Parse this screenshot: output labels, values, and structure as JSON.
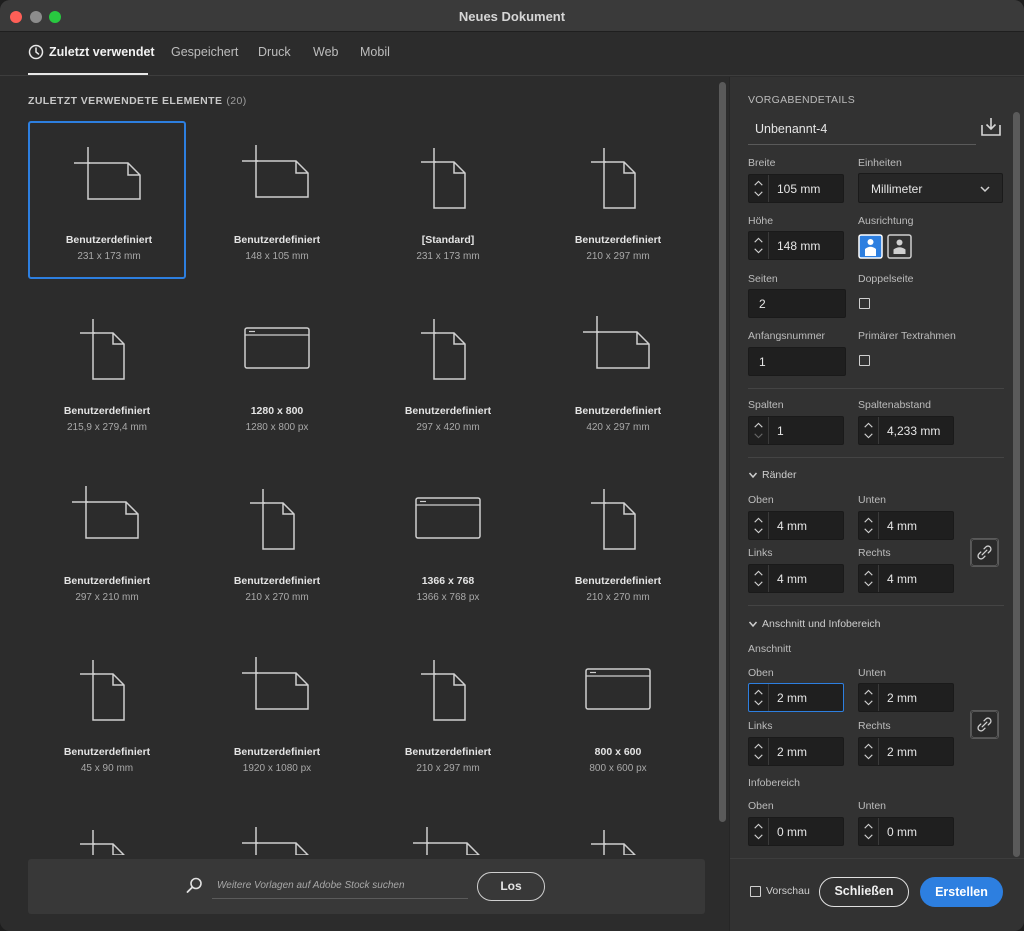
{
  "window": {
    "title": "Neues Dokument"
  },
  "tabs": [
    {
      "label": "Zuletzt verwendet",
      "active": true,
      "icon": "clock-icon"
    },
    {
      "label": "Gespeichert",
      "active": false
    },
    {
      "label": "Druck",
      "active": false
    },
    {
      "label": "Web",
      "active": false
    },
    {
      "label": "Mobil",
      "active": false
    }
  ],
  "recent": {
    "heading": "ZULETZT VERWENDETE ELEMENTE",
    "count": "(20)",
    "items": [
      {
        "name": "Benutzerdefiniert",
        "size": "231 x 173 mm",
        "icon": "landscape-page-icon",
        "selected": true
      },
      {
        "name": "Benutzerdefiniert",
        "size": "148 x 105 mm",
        "icon": "landscape-page-icon",
        "selected": false
      },
      {
        "name": "[Standard]",
        "size": "231 x 173 mm",
        "icon": "portrait-page-icon",
        "selected": false
      },
      {
        "name": "Benutzerdefiniert",
        "size": "210 x 297 mm",
        "icon": "portrait-page-icon",
        "selected": false
      },
      {
        "name": "Benutzerdefiniert",
        "size": "215,9 x 279,4 mm",
        "icon": "portrait-page-icon",
        "selected": false
      },
      {
        "name": "1280 x 800",
        "size": "1280 x 800 px",
        "icon": "browser-window-icon",
        "selected": false
      },
      {
        "name": "Benutzerdefiniert",
        "size": "297 x 420 mm",
        "icon": "portrait-page-icon",
        "selected": false
      },
      {
        "name": "Benutzerdefiniert",
        "size": "420 x 297 mm",
        "icon": "landscape-page-icon",
        "selected": false
      },
      {
        "name": "Benutzerdefiniert",
        "size": "297 x 210 mm",
        "icon": "landscape-page-icon",
        "selected": false
      },
      {
        "name": "Benutzerdefiniert",
        "size": "210 x 270 mm",
        "icon": "portrait-page-icon",
        "selected": false
      },
      {
        "name": "1366 x 768",
        "size": "1366 x 768 px",
        "icon": "browser-window-icon",
        "selected": false
      },
      {
        "name": "Benutzerdefiniert",
        "size": "210 x 270 mm",
        "icon": "portrait-page-icon",
        "selected": false
      },
      {
        "name": "Benutzerdefiniert",
        "size": "45 x 90 mm",
        "icon": "portrait-page-icon",
        "selected": false
      },
      {
        "name": "Benutzerdefiniert",
        "size": "1920 x 1080 px",
        "icon": "landscape-page-icon",
        "selected": false
      },
      {
        "name": "Benutzerdefiniert",
        "size": "210 x 297 mm",
        "icon": "portrait-page-icon",
        "selected": false
      },
      {
        "name": "800 x 600",
        "size": "800 x 600 px",
        "icon": "browser-window-icon",
        "selected": false
      },
      {
        "name": "",
        "size": "",
        "icon": "portrait-page-icon",
        "selected": false
      },
      {
        "name": "",
        "size": "",
        "icon": "landscape-page-icon",
        "selected": false
      },
      {
        "name": "",
        "size": "",
        "icon": "landscape-page-icon",
        "selected": false
      },
      {
        "name": "",
        "size": "",
        "icon": "portrait-page-icon",
        "selected": false
      }
    ]
  },
  "search": {
    "placeholder": "Weitere Vorlagen auf Adobe Stock suchen",
    "button": "Los"
  },
  "details": {
    "heading": "VORGABENDETAILS",
    "preset_name": "Unbenannt-4",
    "width_label": "Breite",
    "width_value": "105 mm",
    "units_label": "Einheiten",
    "units_value": "Millimeter",
    "height_label": "Höhe",
    "height_value": "148 mm",
    "orientation_label": "Ausrichtung",
    "pages_label": "Seiten",
    "pages_value": "2",
    "facing_label": "Doppelseite",
    "facing_checked": false,
    "start_label": "Anfangsnummer",
    "start_value": "1",
    "primary_label": "Primärer Textrahmen",
    "primary_checked": false,
    "columns_label": "Spalten",
    "columns_value": "1",
    "gutter_label": "Spaltenabstand",
    "gutter_value": "4,233 mm"
  },
  "margins": {
    "toggle": "Ränder",
    "top_label": "Oben",
    "top_value": "4 mm",
    "bottom_label": "Unten",
    "bottom_value": "4 mm",
    "left_label": "Links",
    "left_value": "4 mm",
    "right_label": "Rechts",
    "right_value": "4 mm"
  },
  "bleed": {
    "toggle": "Anschnitt und Infobereich",
    "bleed_label": "Anschnitt",
    "top_label": "Oben",
    "top_value": "2 mm",
    "bottom_label": "Unten",
    "bottom_value": "2 mm",
    "left_label": "Links",
    "left_value": "2 mm",
    "right_label": "Rechts",
    "right_value": "2 mm",
    "slug_label": "Infobereich",
    "slug_top_label": "Oben",
    "slug_top_value": "0 mm",
    "slug_bottom_label": "Unten",
    "slug_bottom_value": "0 mm"
  },
  "footer": {
    "preview_label": "Vorschau",
    "preview_checked": false,
    "close_button": "Schließen",
    "create_button": "Erstellen"
  },
  "colors": {
    "accent": "#2d7fe0",
    "background": "#2c2c2c",
    "panel": "#323232"
  }
}
